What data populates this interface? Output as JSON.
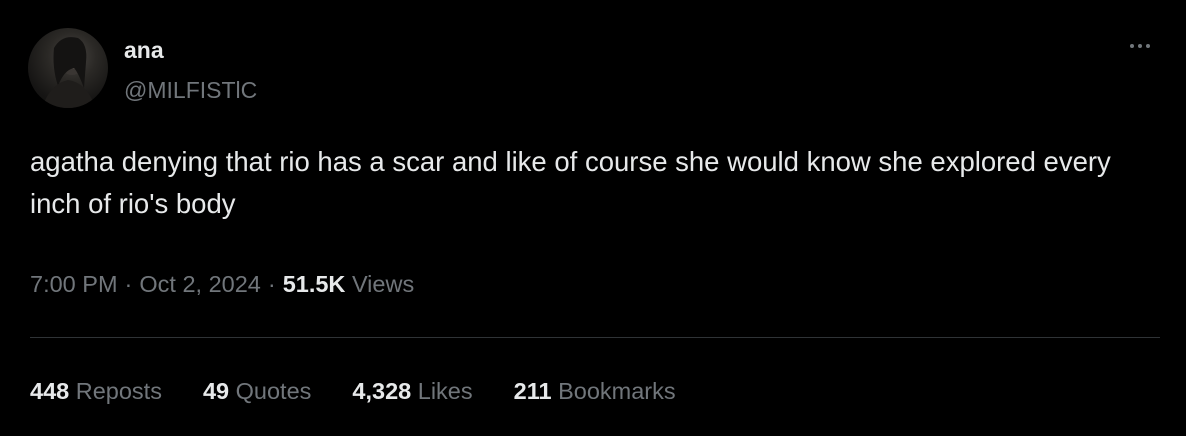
{
  "user": {
    "display_name": "ana",
    "handle": "@MILFISTlC"
  },
  "tweet": {
    "text": "agatha denying that rio has a scar and like of course she would know she explored every inch of rio's body",
    "time": "7:00 PM",
    "separator": "·",
    "date": "Oct 2, 2024",
    "views_count": "51.5K",
    "views_label": "Views"
  },
  "stats": {
    "reposts": {
      "count": "448",
      "label": "Reposts"
    },
    "quotes": {
      "count": "49",
      "label": "Quotes"
    },
    "likes": {
      "count": "4,328",
      "label": "Likes"
    },
    "bookmarks": {
      "count": "211",
      "label": "Bookmarks"
    }
  },
  "icons": {
    "more": "more-horizontal-icon"
  },
  "colors": {
    "background": "#000000",
    "primary_text": "#e7e9ea",
    "secondary_text": "#71767b",
    "divider": "#2f3336"
  }
}
